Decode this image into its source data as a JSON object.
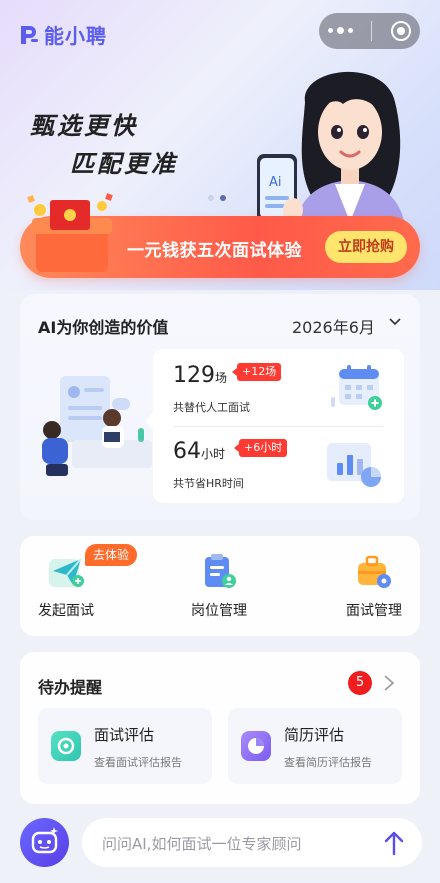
{
  "header": {
    "logo_text": "能小聘",
    "slogan_line1": "甄选更快",
    "slogan_line2": "匹配更准",
    "phone_text": "Ai"
  },
  "promo": {
    "text": "一元钱获五次面试体验",
    "button": "立即抢购"
  },
  "value_card": {
    "title": "AI为你创造的价值",
    "month": "2026年6月",
    "stats": [
      {
        "number": "129",
        "unit": "场",
        "tag": "+12场",
        "desc": "共替代人工面试"
      },
      {
        "number": "64",
        "unit": "小时",
        "tag": "+6小时",
        "desc": "共节省HR时间"
      }
    ]
  },
  "quick_actions": {
    "trial_badge": "去体验",
    "items": [
      {
        "label": "发起面试",
        "icon": "paper-plane-icon"
      },
      {
        "label": "岗位管理",
        "icon": "clipboard-user-icon"
      },
      {
        "label": "面试管理",
        "icon": "briefcase-gear-icon"
      }
    ]
  },
  "todo": {
    "title": "待办提醒",
    "count": "5",
    "items": [
      {
        "name": "面试评估",
        "sub": "查看面试评估报告",
        "icon": "target-icon"
      },
      {
        "name": "简历评估",
        "sub": "查看简历评估报告",
        "icon": "pie-chart-icon"
      }
    ]
  },
  "chat": {
    "placeholder": "问问AI,如何面试一位专家顾问"
  },
  "colors": {
    "brand": "#5b5cf0",
    "promo": "#ff5a49",
    "badge_red": "#ff3a32",
    "trial_orange": "#ff6b2b"
  }
}
